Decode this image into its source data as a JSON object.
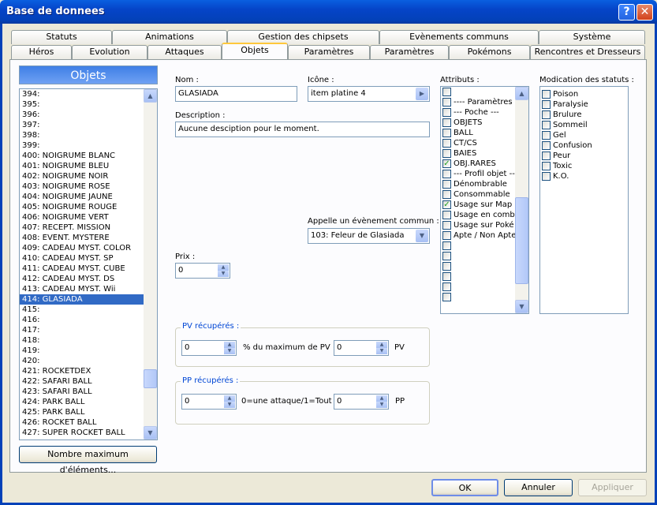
{
  "window": {
    "title": "Base de donnees"
  },
  "tabs_row1": [
    "Statuts",
    "Animations",
    "Gestion des chipsets",
    "Evènements communs",
    "Système"
  ],
  "tabs_row2": [
    "Héros",
    "Evolution",
    "Attaques",
    "Objets",
    "Paramètres",
    "Paramètres",
    "Pokémons",
    "Rencontres et Dresseurs"
  ],
  "list": {
    "header": "Objets",
    "items": [
      "394:",
      "395:",
      "396:",
      "397:",
      "398:",
      "399:",
      "400: NOIGRUME BLANC",
      "401: NOIGRUME BLEU",
      "402: NOIGRUME NOIR",
      "403: NOIGRUME ROSE",
      "404: NOIGRUME JAUNE",
      "405: NOIGRUME ROUGE",
      "406: NOIGRUME VERT",
      "407: RECEPT. MISSION",
      "408: EVENT. MYSTERE",
      "409: CADEAU MYST. COLOR",
      "410: CADEAU MYST. SP",
      "411: CADEAU MYST. CUBE",
      "412: CADEAU MYST. DS",
      "413: CADEAU MYST. Wii",
      "414: GLASIADA",
      "415:",
      "416:",
      "417:",
      "418:",
      "419:",
      "420:",
      "421: ROCKETDEX",
      "422: SAFARI BALL",
      "423: SAFARI BALL",
      "424: PARK BALL",
      "425: PARK BALL",
      "426: ROCKET BALL",
      "427: SUPER ROCKET BALL"
    ],
    "selected_index": 20,
    "max_button": "Nombre maximum d'éléments..."
  },
  "form": {
    "nom_label": "Nom :",
    "nom_value": "GLASIADA",
    "icone_label": "Icône :",
    "icone_value": "item platine 4",
    "desc_label": "Description :",
    "desc_value": "Aucune desciption pour le moment.",
    "event_label": "Appelle un évènement commun :",
    "event_value": "103: Feleur de Glasiada",
    "prix_label": "Prix :",
    "prix_value": "0"
  },
  "pv_group": {
    "title": "PV récupérés :",
    "value1": "0",
    "text1": "% du maximum de PV +",
    "value2": "0",
    "unit": "PV"
  },
  "pp_group": {
    "title": "PP récupérés :",
    "value1": "0",
    "text1": "0=une attaque/1=Tout",
    "value2": "0",
    "unit": "PP"
  },
  "attributs": {
    "label": "Attributs :",
    "items": [
      {
        "text": "",
        "checked": false
      },
      {
        "text": "---- Paramètres O",
        "checked": false
      },
      {
        "text": "--- Poche ---",
        "checked": false
      },
      {
        "text": "OBJETS",
        "checked": false
      },
      {
        "text": "BALL",
        "checked": false
      },
      {
        "text": "CT/CS",
        "checked": false
      },
      {
        "text": "BAIES",
        "checked": false
      },
      {
        "text": "OBJ.RARES",
        "checked": true
      },
      {
        "text": "--- Profil objet ---",
        "checked": false
      },
      {
        "text": "Dénombrable",
        "checked": false
      },
      {
        "text": "Consommable",
        "checked": false
      },
      {
        "text": "Usage sur Map",
        "checked": true
      },
      {
        "text": "Usage en comb",
        "checked": false
      },
      {
        "text": "Usage sur Poké",
        "checked": false
      },
      {
        "text": "Apte / Non Apte",
        "checked": false
      },
      {
        "text": "",
        "checked": false
      },
      {
        "text": "",
        "checked": false
      },
      {
        "text": "",
        "checked": false
      },
      {
        "text": "",
        "checked": false
      },
      {
        "text": "",
        "checked": false
      },
      {
        "text": "",
        "checked": false
      }
    ]
  },
  "statuts": {
    "label": "Modication des statuts :",
    "items": [
      "Poison",
      "Paralysie",
      "Brulure",
      "Sommeil",
      "Gel",
      "Confusion",
      "Peur",
      "Toxic",
      "K.O."
    ]
  },
  "footer": {
    "ok": "OK",
    "cancel": "Annuler",
    "apply": "Appliquer"
  }
}
